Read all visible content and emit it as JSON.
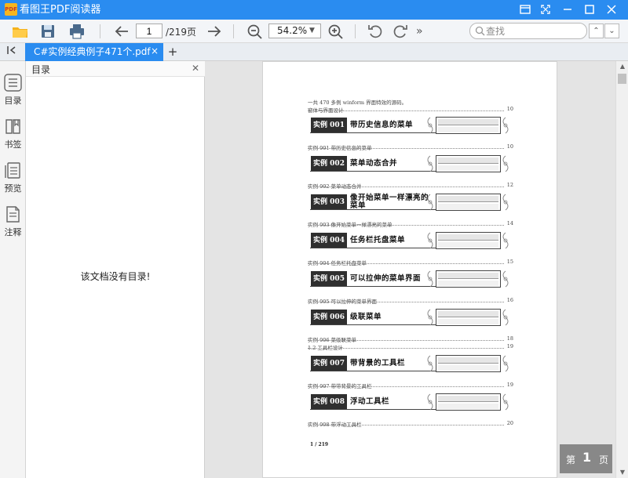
{
  "window": {
    "app_logo_text": "PDF",
    "title": "看图王PDF阅读器"
  },
  "toolbar": {
    "page_current": "1",
    "page_total": "/219页",
    "zoom": "54.2%",
    "search_placeholder": "查找"
  },
  "tabs": {
    "active_label": "C#实例经典例子471个.pdf",
    "close_glyph": "×",
    "add_glyph": "+"
  },
  "sidebar": {
    "items": [
      {
        "label": "目录"
      },
      {
        "label": "书签"
      },
      {
        "label": "预览"
      },
      {
        "label": "注释"
      }
    ]
  },
  "outline_panel": {
    "title": "目录",
    "empty_message": "该文档没有目录!"
  },
  "pdf_page": {
    "intro": "一共 470 多例 winform 界面特效的源码。",
    "section1": {
      "text": "窗体与界面设计",
      "page": "10"
    },
    "section2": {
      "text": "1.2   工具栏设计",
      "page": "19"
    },
    "examples": [
      {
        "badge": "实例 001",
        "title": "带历史信息的菜单",
        "toc": "实例 001   带历史信息的菜单",
        "page": "10"
      },
      {
        "badge": "实例 002",
        "title": "菜单动态合并",
        "toc": "实例 002   菜单动态合并",
        "page": "12"
      },
      {
        "badge": "实例 003",
        "title": "像开始菜单一样漂亮的菜单",
        "toc": "实例 003   像开始菜单一样漂亮的菜单",
        "page": "14"
      },
      {
        "badge": "实例 004",
        "title": "任务栏托盘菜单",
        "toc": "实例 004   任务栏托盘菜单",
        "page": "15"
      },
      {
        "badge": "实例 005",
        "title": "可以拉伸的菜单界面",
        "toc": "实例 005   可以拉伸的菜单界面",
        "page": "16"
      },
      {
        "badge": "实例 006",
        "title": "级联菜单",
        "toc": "实例 006   菜级联菜单",
        "page": "18"
      },
      {
        "badge": "实例 007",
        "title": "带背景的工具栏",
        "toc": "实例 007   带带背景的工具栏",
        "page": "19"
      },
      {
        "badge": "实例 008",
        "title": "浮动工具栏",
        "toc": "实例 008   带浮动工具栏",
        "page": "20"
      }
    ],
    "folio": "1 / 219"
  },
  "page_badge": {
    "prefix": "第",
    "number": "1",
    "suffix": "页"
  },
  "colors": {
    "accent": "#2a8cf0",
    "toolbar_bg": "#f3f5f8"
  }
}
